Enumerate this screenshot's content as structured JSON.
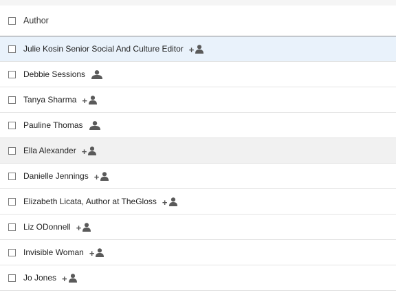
{
  "header": {
    "column_label": "Author"
  },
  "rows": [
    {
      "name": "Julie Kosin Senior Social And Culture Editor",
      "icon": "add-user-icon",
      "plus": "+"
    },
    {
      "name": "Debbie Sessions",
      "icon": "user-icon"
    },
    {
      "name": "Tanya Sharma",
      "icon": "add-user-icon",
      "plus": "+"
    },
    {
      "name": "Pauline Thomas",
      "icon": "user-icon"
    },
    {
      "name": "Ella Alexander",
      "icon": "add-user-icon",
      "plus": "+"
    },
    {
      "name": "Danielle Jennings",
      "icon": "add-user-icon",
      "plus": "+"
    },
    {
      "name": "Elizabeth Licata, Author at TheGloss",
      "icon": "add-user-icon",
      "plus": "+"
    },
    {
      "name": "Liz ODonnell",
      "icon": "add-user-icon",
      "plus": "+"
    },
    {
      "name": "Invisible Woman",
      "icon": "add-user-icon",
      "plus": "+"
    },
    {
      "name": "Jo Jones",
      "icon": "add-user-icon",
      "plus": "+"
    }
  ],
  "colors": {
    "selected_row": "#e9f2fb",
    "hover_row": "#f1f1f1",
    "icon": "#5a5a5a"
  }
}
